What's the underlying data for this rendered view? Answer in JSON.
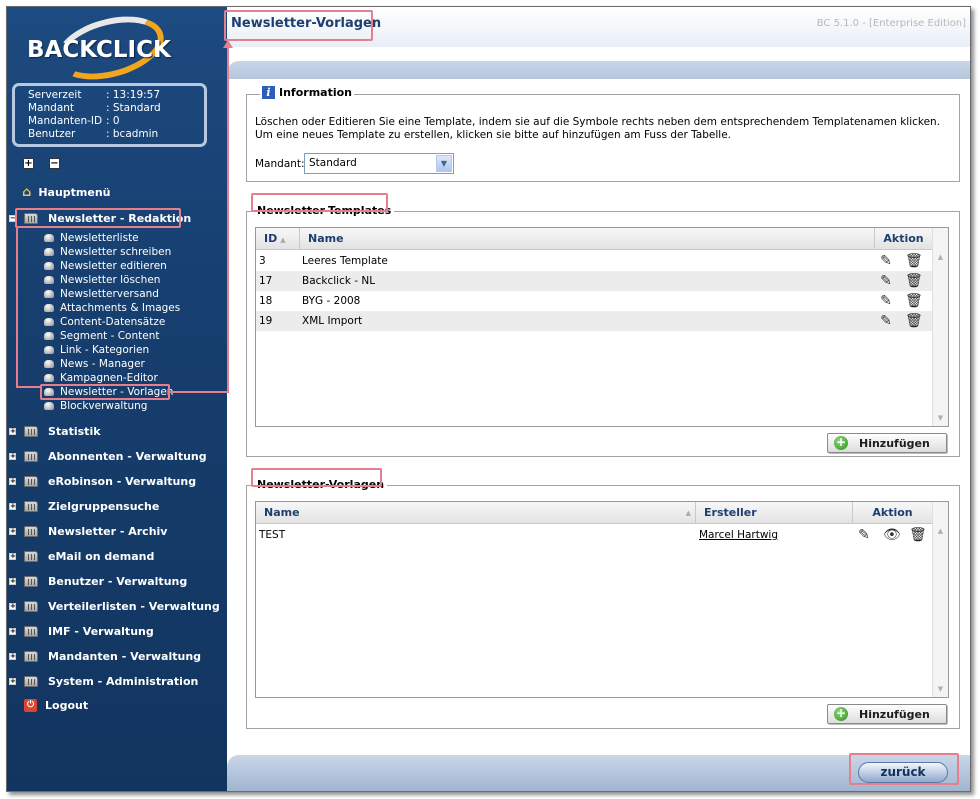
{
  "app": {
    "logo_text": "BACKCLICK",
    "version": "BC 5.1.0 - [Enterprise Edition]"
  },
  "server_info": [
    {
      "key": "Serverzeit",
      "value": ": 13:19:57"
    },
    {
      "key": "Mandant",
      "value": ": Standard"
    },
    {
      "key": "Mandanten-ID",
      "value": ": 0"
    },
    {
      "key": "Benutzer",
      "value": ": bcadmin"
    }
  ],
  "sidebar": {
    "expand_all": "+",
    "collapse_all": "−",
    "home": "Hauptmenü",
    "active_section": "Newsletter - Redaktion",
    "sub_items": [
      "Newsletterliste",
      "Newsletter schreiben",
      "Newsletter editieren",
      "Newsletter löschen",
      "Newsletterversand",
      "Attachments & Images",
      "Content-Datensätze",
      "Segment - Content",
      "Link - Kategorien",
      "News - Manager",
      "Kampagnen-Editor",
      "Newsletter - Vorlagen",
      "Blockverwaltung"
    ],
    "sections": [
      "Statistik",
      "Abonnenten - Verwaltung",
      "eRobinson - Verwaltung",
      "Zielgruppensuche",
      "Newsletter - Archiv",
      "eMail on demand",
      "Benutzer - Verwaltung",
      "Verteilerlisten - Verwaltung",
      "IMF - Verwaltung",
      "Mandanten - Verwaltung",
      "System - Administration"
    ],
    "logout": "Logout"
  },
  "page": {
    "title": "Newsletter-Vorlagen",
    "back_button": "zurück"
  },
  "information": {
    "legend": "Information",
    "line1": "Löschen oder Editieren Sie eine Template, indem sie auf die Symbole rechts neben dem entsprechendem Templatenamen klicken.",
    "line2": "Um eine neues Template zu erstellen, klicken sie bitte auf hinzufügen am Fuss der Tabelle.",
    "mandant_label": "Mandant:",
    "mandant_value": "Standard"
  },
  "templates": {
    "legend": "Newsletter-Templates",
    "headers": {
      "id": "ID",
      "name": "Name",
      "action": "Aktion"
    },
    "rows": [
      {
        "id": "3",
        "name": "Leeres Template"
      },
      {
        "id": "17",
        "name": "Backclick - NL"
      },
      {
        "id": "18",
        "name": "BYG - 2008"
      },
      {
        "id": "19",
        "name": "XML Import"
      }
    ],
    "add_button": "Hinzufügen"
  },
  "vorlagen": {
    "legend": "Newsletter-Vorlagen",
    "headers": {
      "name": "Name",
      "creator": "Ersteller",
      "action": "Aktion"
    },
    "rows": [
      {
        "name": "TEST",
        "creator": "Marcel Hartwig"
      }
    ],
    "add_button": "Hinzufügen"
  },
  "colors": {
    "sidebar": "#1d4a80",
    "accent": "#f2a51e",
    "annotation": "#e57f8b",
    "header_text": "#1d3f70"
  }
}
